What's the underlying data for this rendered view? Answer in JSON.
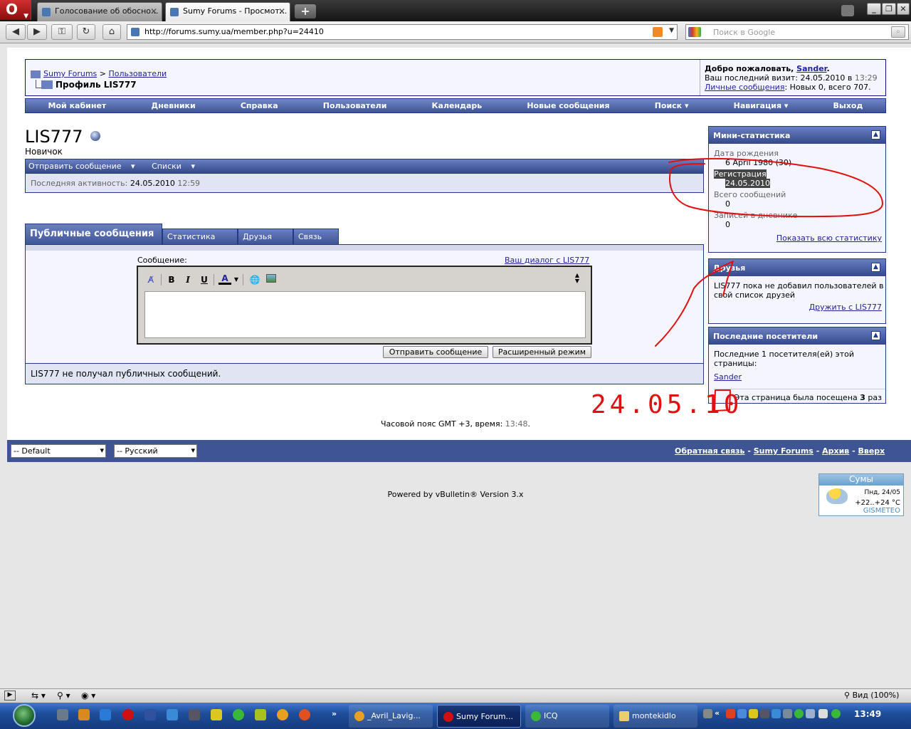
{
  "browser": {
    "tabs": [
      {
        "title": "Голосование об обосно..."
      },
      {
        "title": "Sumy Forums - Просмот..."
      }
    ],
    "url": "http://forums.sumy.ua/member.php?u=24410",
    "search_placeholder": "Поиск в Google",
    "status_zoom": "Вид (100%)"
  },
  "header": {
    "crumb_root": "Sumy Forums",
    "crumb_sep": ">",
    "crumb_parent": "Пользователи",
    "crumb_current": "Профиль LIS777",
    "welcome_prefix": "Добро пожаловать, ",
    "welcome_user": "Sander",
    "welcome_suffix": ".",
    "last_visit_prefix": "Ваш последний визит: 24.05.2010 в ",
    "last_visit_time": "13:29",
    "pm_link": "Личные сообщения",
    "pm_counts": ": Новых 0, всего 707."
  },
  "nav": [
    "Мой кабинет",
    "Дневники",
    "Справка",
    "Пользователи",
    "Календарь",
    "Новые сообщения",
    "Поиск",
    "Навигация",
    "Выход"
  ],
  "profile": {
    "username": "LIS777",
    "rank": "Новичок",
    "send_message": "Отправить сообщение",
    "lists": "Списки",
    "activity_label": "Последняя активность: ",
    "activity_date": "24.05.2010",
    "activity_time": "12:59"
  },
  "tabs": [
    "Публичные сообщения",
    "Статистика",
    "Друзья",
    "Связь"
  ],
  "message_form": {
    "label": "Сообщение:",
    "dialog_link": "Ваш диалог с LIS777",
    "submit": "Отправить сообщение",
    "advanced": "Расширенный режим",
    "no_messages": "LIS777 не получал публичных сообщений."
  },
  "mini_stats": {
    "title": "Мини-статистика",
    "birthday_label": "Дата рождения",
    "birthday_value": "6 April 1980 (30)",
    "registration_label": "Регистрация",
    "registration_value": "24.05.2010",
    "posts_label": "Всего сообщений",
    "posts_value": "0",
    "blog_label": "Записей в дневнике",
    "blog_value": "0",
    "show_all": "Показать всю статистику"
  },
  "friends": {
    "title": "Друзья",
    "text": "LIS777 пока не добавил пользователей в свой список друзей",
    "link": "Дружить с LIS777"
  },
  "visitors": {
    "title": "Последние посетители",
    "text": "Последние 1 посетителя(ей) этой страницы:",
    "user": "Sander",
    "visits_prefix": "Эта страница была посещена ",
    "visits_count": "3",
    "visits_suffix": " раз"
  },
  "footer": {
    "timezone_prefix": "Часовой пояс GMT +3, время: ",
    "time": "13:48",
    "timezone_suffix": ".",
    "style_select": "-- Default",
    "lang_select": "-- Русский",
    "links": [
      "Обратная связь",
      "Sumy Forums",
      "Архив",
      "Вверх"
    ],
    "powered": "Powered by vBulletin® Version 3.x"
  },
  "weather": {
    "city": "Сумы",
    "date": "Пнд, 24/05",
    "temp": "+22..+24 °C",
    "brand": "GISMETEO"
  },
  "annotation": {
    "handwritten_date": "24.05.10",
    "color": "#e01010"
  },
  "taskbar": {
    "tasks": [
      "_Avril_Lavig...",
      "Sumy Forum...",
      "ICQ",
      "montekidlo"
    ],
    "clock": "13:49"
  }
}
